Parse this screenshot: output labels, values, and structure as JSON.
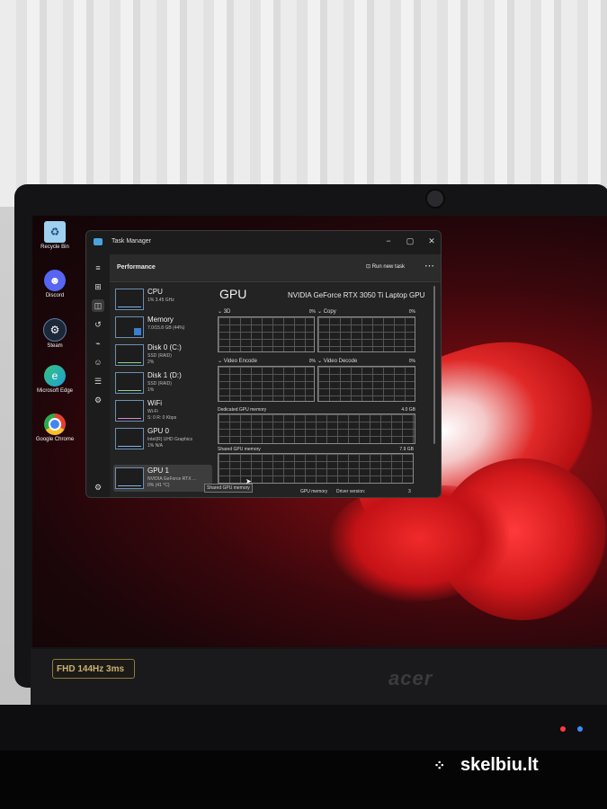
{
  "desktop_icons": [
    {
      "label": "Recycle Bin",
      "icon": "recycle-bin-icon",
      "color": "#9fd0f0"
    },
    {
      "label": "Discord",
      "icon": "discord-icon",
      "color": "#5865f2"
    },
    {
      "label": "Steam",
      "icon": "steam-icon",
      "color": "#1b2838"
    },
    {
      "label": "Microsoft Edge",
      "icon": "edge-icon",
      "color": "#1fa0d8"
    },
    {
      "label": "Google Chrome",
      "icon": "chrome-icon",
      "color": "#e34133"
    }
  ],
  "window": {
    "title": "Task Manager",
    "minimize": "−",
    "maximize": "▢",
    "close": "✕"
  },
  "header": {
    "title": "Performance",
    "run_new_task": "Run new task",
    "more": "⋯"
  },
  "nav": [
    {
      "name": "menu-icon",
      "glyph": "≡"
    },
    {
      "name": "processes-icon",
      "glyph": "⊞"
    },
    {
      "name": "performance-icon",
      "glyph": "◫"
    },
    {
      "name": "app-history-icon",
      "glyph": "↺"
    },
    {
      "name": "startup-apps-icon",
      "glyph": "⌁"
    },
    {
      "name": "users-icon",
      "glyph": "☺"
    },
    {
      "name": "details-icon",
      "glyph": "☰"
    },
    {
      "name": "services-icon",
      "glyph": "⚙"
    },
    {
      "name": "settings-icon",
      "glyph": "⚙"
    }
  ],
  "perf_items": [
    {
      "name": "CPU",
      "line1": "1% 3.45 GHz",
      "line2": ""
    },
    {
      "name": "Memory",
      "line1": "7.0/15.8 GB (44%)",
      "line2": ""
    },
    {
      "name": "Disk 0 (C:)",
      "line1": "SSD (RAID)",
      "line2": "2%"
    },
    {
      "name": "Disk 1 (D:)",
      "line1": "SSD (RAID)",
      "line2": "1%"
    },
    {
      "name": "WiFi",
      "line1": "Wi-Fi",
      "line2": "S: 0 R: 0 Kbps"
    },
    {
      "name": "GPU 0",
      "line1": "Intel(R) UHD Graphics",
      "line2": "1% N/A"
    },
    {
      "name": "GPU 1",
      "line1": "NVIDIA GeForce RTX ...",
      "line2": "0% (41 °C)"
    }
  ],
  "gpu": {
    "heading": "GPU",
    "model": "NVIDIA GeForce RTX 3050 Ti Laptop GPU",
    "engines": [
      {
        "label": "3D",
        "value": "0%"
      },
      {
        "label": "Copy",
        "value": "0%"
      },
      {
        "label": "Video Encode",
        "value": "0%"
      },
      {
        "label": "Video Decode",
        "value": "0%"
      }
    ],
    "dedicated_label": "Dedicated GPU memory",
    "dedicated_value": "4.0 GB",
    "shared_label": "Shared GPU memory",
    "shared_value": "7.9 GB",
    "footer_utilization": "Utilization",
    "footer_dedicated": "GPU memory",
    "footer_driver": "Driver version:",
    "footer_driver_value": "3",
    "tooltip": "Shared GPU memory"
  },
  "laptop": {
    "badge": "FHD 144Hz 3ms",
    "brand": "acer"
  },
  "watermark": {
    "dots": "⁘",
    "text": "skelbiu.lt"
  }
}
